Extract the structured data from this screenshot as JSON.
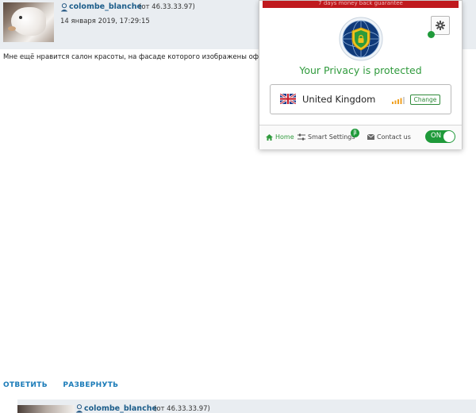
{
  "post": {
    "username": "colombe_blanche",
    "ip": "(от 46.33.33.97)",
    "timestamp": "14 января 2019, 17:29:15",
    "text": "Мне ещё нравится салон красоты, на фасаде которого изображены офи"
  },
  "actions": {
    "reply": "ОТВЕТИТЬ",
    "expand": "РАЗВЕРНУТЬ"
  },
  "post2": {
    "username": "colombe_blanche",
    "ip": "(от 46.33.33.97)"
  },
  "vpn": {
    "banner": "7 days money back guarantee",
    "status": "Your Privacy is protected",
    "country": "United Kingdom",
    "change_label": "Change",
    "footer": {
      "home": "Home",
      "smart_settings": "Smart Settings",
      "beta_badge": "β",
      "contact": "Contact us",
      "toggle": "ON"
    },
    "colors": {
      "accent_green": "#1f9a3a",
      "banner_red": "#c0191d"
    },
    "icons": [
      "gear-icon",
      "shield-logo",
      "uk-flag-icon",
      "signal-icon",
      "home-icon",
      "sliders-icon",
      "mail-icon"
    ]
  }
}
